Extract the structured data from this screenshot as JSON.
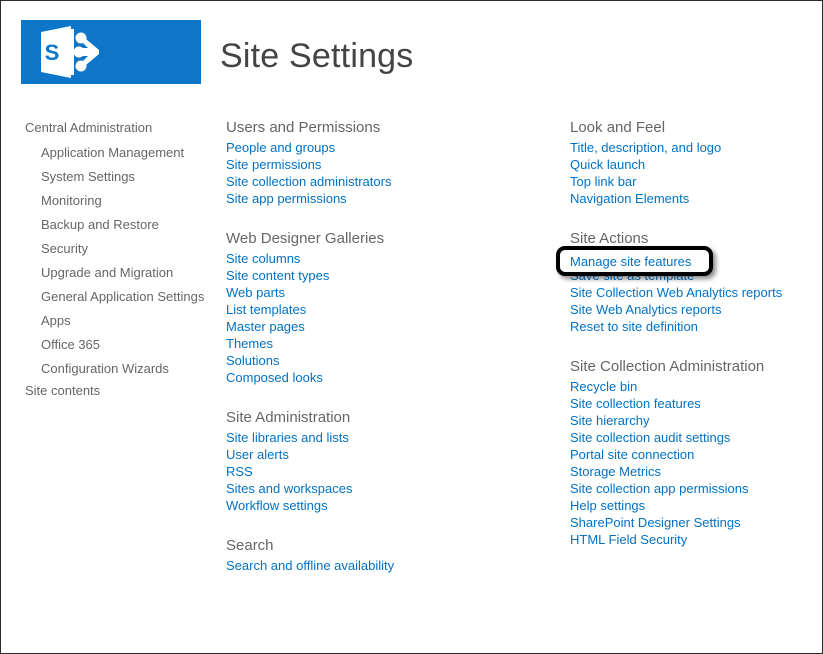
{
  "header": {
    "title": "Site Settings",
    "logo_icon": "sharepoint-logo-icon",
    "logo_letter": "S",
    "brand_color": "#0e76c8"
  },
  "colors": {
    "link": "#0072c6",
    "heading": "#666666",
    "title": "#444444",
    "annotation": "#000000"
  },
  "sidebar": {
    "root": "Central Administration",
    "items": [
      {
        "label": "Application Management"
      },
      {
        "label": "System Settings"
      },
      {
        "label": "Monitoring"
      },
      {
        "label": "Backup and Restore"
      },
      {
        "label": "Security"
      },
      {
        "label": "Upgrade and Migration"
      },
      {
        "label": "General Application Settings"
      },
      {
        "label": "Apps"
      },
      {
        "label": "Office 365"
      },
      {
        "label": "Configuration Wizards"
      }
    ],
    "site_contents": "Site contents"
  },
  "columns": {
    "middle": [
      {
        "title": "Users and Permissions",
        "links": [
          "People and groups",
          "Site permissions",
          "Site collection administrators",
          "Site app permissions"
        ]
      },
      {
        "title": "Web Designer Galleries",
        "links": [
          "Site columns",
          "Site content types",
          "Web parts",
          "List templates",
          "Master pages",
          "Themes",
          "Solutions",
          "Composed looks"
        ]
      },
      {
        "title": "Site Administration",
        "links": [
          "Site libraries and lists",
          "User alerts",
          "RSS",
          "Sites and workspaces",
          "Workflow settings"
        ]
      },
      {
        "title": "Search",
        "links": [
          "Search and offline availability"
        ]
      }
    ],
    "right": [
      {
        "title": "Look and Feel",
        "links": [
          "Title, description, and logo",
          "Quick launch",
          "Top link bar",
          "Navigation Elements"
        ]
      },
      {
        "title": "Site Actions",
        "links": [
          "Manage site features",
          "Save site as template",
          "Site Collection Web Analytics reports",
          "Site Web Analytics reports",
          "Reset to site definition"
        ]
      },
      {
        "title": "Site Collection Administration",
        "links": [
          "Recycle bin",
          "Site collection features",
          "Site hierarchy",
          "Site collection audit settings",
          "Portal site connection",
          "Storage Metrics",
          "Site collection app permissions",
          "Help settings",
          "SharePoint Designer Settings",
          "HTML Field Security"
        ]
      }
    ]
  },
  "annotation": {
    "highlighted_link": "Manage site features"
  }
}
